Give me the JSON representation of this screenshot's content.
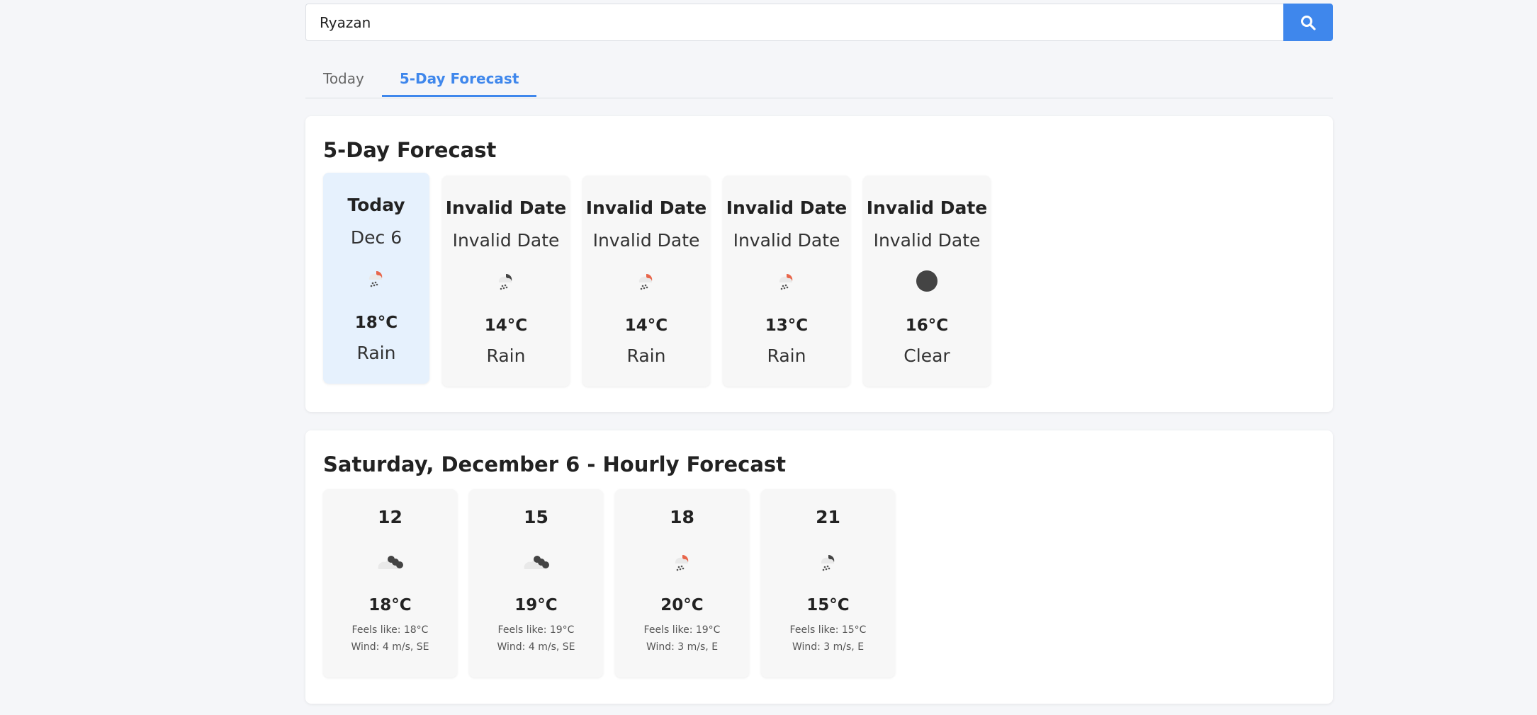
{
  "search": {
    "value": "Ryazan",
    "button_icon": "search-icon"
  },
  "tabs": [
    {
      "label": "Today",
      "active": false
    },
    {
      "label": "5-Day Forecast",
      "active": true
    }
  ],
  "forecast": {
    "title": "5-Day Forecast",
    "days": [
      {
        "name": "Today",
        "date": "Dec 6",
        "icon": "rain-sun-icon",
        "temp": "18°C",
        "condition": "Rain",
        "selected": true
      },
      {
        "name": "Invalid Date",
        "date": "Invalid Date",
        "icon": "rain-night-icon",
        "temp": "14°C",
        "condition": "Rain",
        "selected": false
      },
      {
        "name": "Invalid Date",
        "date": "Invalid Date",
        "icon": "rain-sun-icon",
        "temp": "14°C",
        "condition": "Rain",
        "selected": false
      },
      {
        "name": "Invalid Date",
        "date": "Invalid Date",
        "icon": "rain-sun-icon",
        "temp": "13°C",
        "condition": "Rain",
        "selected": false
      },
      {
        "name": "Invalid Date",
        "date": "Invalid Date",
        "icon": "clear-night-icon",
        "temp": "16°C",
        "condition": "Clear",
        "selected": false
      }
    ]
  },
  "hourly": {
    "title": "Saturday, December 6 - Hourly Forecast",
    "hours": [
      {
        "time": "12",
        "icon": "broken-clouds-icon",
        "temp": "18°C",
        "feels": "Feels like: 18°C",
        "wind": "Wind: 4 m/s, SE"
      },
      {
        "time": "15",
        "icon": "broken-clouds-icon",
        "temp": "19°C",
        "feels": "Feels like: 19°C",
        "wind": "Wind: 4 m/s, SE"
      },
      {
        "time": "18",
        "icon": "rain-sun-icon",
        "temp": "20°C",
        "feels": "Feels like: 19°C",
        "wind": "Wind: 3 m/s, E"
      },
      {
        "time": "21",
        "icon": "rain-night-icon",
        "temp": "15°C",
        "feels": "Feels like: 15°C",
        "wind": "Wind: 3 m/s, E"
      }
    ]
  },
  "colors": {
    "accent": "#3f87ec",
    "sun": "#e8664b",
    "selected_bg": "#e6f1fd"
  }
}
